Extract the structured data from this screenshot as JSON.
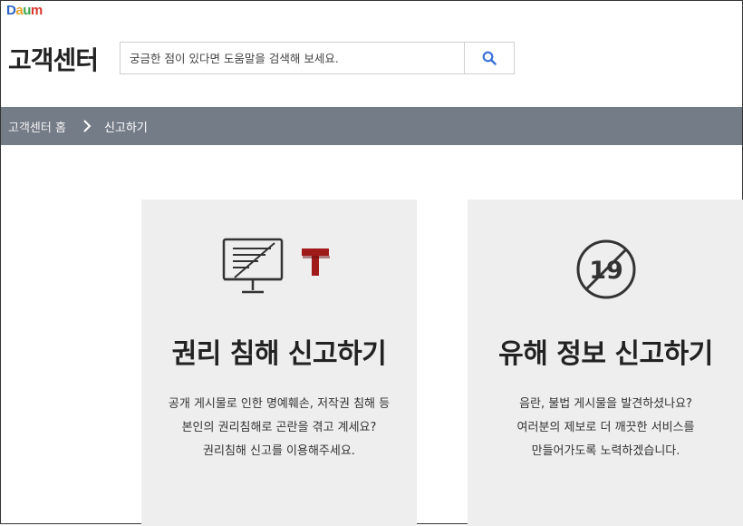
{
  "logo": {
    "parts": [
      "D",
      "a",
      "u",
      "m"
    ]
  },
  "header": {
    "title": "고객센터"
  },
  "search": {
    "placeholder": "궁금한 점이 있다면 도움말을 검색해 보세요.",
    "button_icon": "search-icon",
    "accent": "#3b6fd9"
  },
  "breadcrumb": {
    "home": "고객센터 홈",
    "separator_icon": "chevron-right-icon",
    "current": "신고하기"
  },
  "cards": [
    {
      "icon": "monitor-crossed-icon",
      "badge_text": "T",
      "badge_color": "#a11a1a",
      "title": "권리 침해 신고하기",
      "lines": [
        "공개 게시물로 인한 명예훼손, 저작권 침해 등",
        "본인의 권리침해로 곤란을 겪고 계세요?",
        "권리침해 신고를 이용해주세요."
      ]
    },
    {
      "icon": "no-19-icon",
      "icon_text": "19",
      "title": "유해 정보 신고하기",
      "lines": [
        "음란, 불법 게시물을 발견하셨나요?",
        "여러분의 제보로 더 깨끗한 서비스를",
        "만들어가도록 노력하겠습니다."
      ]
    }
  ],
  "colors": {
    "nav_bg": "#747c87",
    "card_bg": "#eeeeef"
  }
}
